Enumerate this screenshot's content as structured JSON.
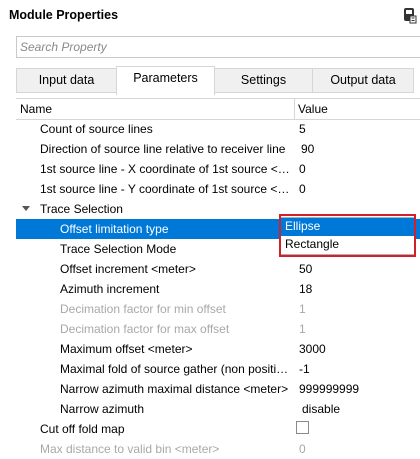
{
  "window": {
    "title": "Module Properties",
    "header_icon": "pin-icon"
  },
  "search": {
    "placeholder": "Search Property",
    "value": ""
  },
  "tabs": [
    {
      "label": "Input data",
      "active": false
    },
    {
      "label": "Parameters",
      "active": true
    },
    {
      "label": "Settings",
      "active": false
    },
    {
      "label": "Output data",
      "active": false
    }
  ],
  "grid": {
    "header": {
      "name": "Name",
      "value": "Value"
    },
    "rows": [
      {
        "name": "Count of source lines",
        "value": "5",
        "enabled": true
      },
      {
        "name": "Direction of source line relative to receiver line",
        "value": "90",
        "enabled": true
      },
      {
        "name": "1st source line - X coordinate of 1st source <…",
        "value": "0",
        "enabled": true
      },
      {
        "name": "1st source line - Y coordinate of 1st source <…",
        "value": "0",
        "enabled": true
      },
      {
        "name": "Trace Selection",
        "value": "",
        "enabled": true,
        "group": true,
        "expanded": true
      },
      {
        "name": "Offset limitation type",
        "value": "Ellipse",
        "enabled": true,
        "selected": true
      },
      {
        "name": "Trace Selection Mode",
        "value": "",
        "enabled": true
      },
      {
        "name": "Offset increment <meter>",
        "value": "50",
        "enabled": true
      },
      {
        "name": "Azimuth increment",
        "value": "18",
        "enabled": true
      },
      {
        "name": "Decimation factor for min offset",
        "value": "1",
        "enabled": false
      },
      {
        "name": "Decimation factor for max offset",
        "value": "1",
        "enabled": false
      },
      {
        "name": "Maximum offset <meter>",
        "value": "3000",
        "enabled": true
      },
      {
        "name": "Maximal fold of source gather (non positi…",
        "value": "-1",
        "enabled": true
      },
      {
        "name": "Narrow azimuth maximal distance <meter>",
        "value": "999999999",
        "enabled": true
      },
      {
        "name": "Narrow azimuth",
        "value": "disable",
        "enabled": true
      },
      {
        "name": "Cut off fold map",
        "value": "",
        "enabled": true,
        "checkbox": true,
        "checked": false
      },
      {
        "name": "Max distance to valid bin <meter>",
        "value": "0",
        "enabled": false
      }
    ]
  },
  "dropdown": {
    "options": [
      "Ellipse",
      "Rectangle"
    ],
    "selected": "Ellipse",
    "highlight_color": "#d3212c"
  },
  "colors": {
    "selection": "#0078d7",
    "highlight_box": "#d3212c"
  }
}
